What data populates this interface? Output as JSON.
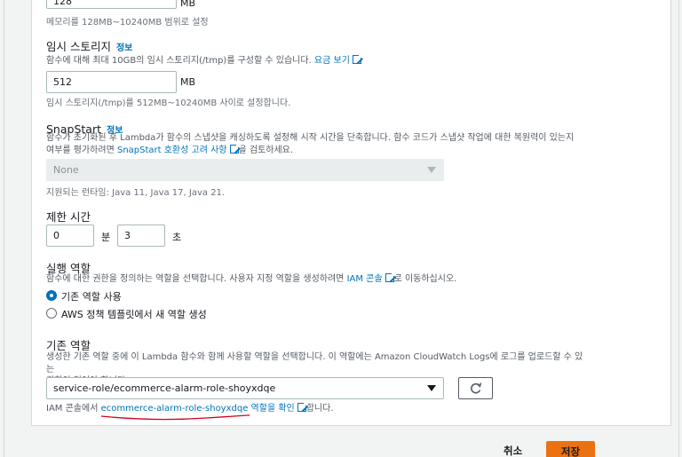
{
  "memory": {
    "value": "128",
    "unit": "MB",
    "hint": "메모리를 128MB~10240MB 범위로 설정"
  },
  "ephemeral": {
    "label": "임시 스토리지",
    "info": "정보",
    "desc_prefix": "함수에 대해 최대 10GB의 임시 스토리지(/tmp)를 구성할 수 있습니다.",
    "pricing_link": "요금 보기",
    "value": "512",
    "unit": "MB",
    "hint": "임시 스토리지(/tmp)를 512MB~10240MB 사이로 설정합니다."
  },
  "snapstart": {
    "label": "SnapStart",
    "info": "정보",
    "desc_line1": "함수가 초기화된 후 Lambda가 함수의 스냅샷을 캐싱하도록 설정해 시작 시간을 단축합니다. 함수 코드가 스냅샷 작업에 대한 복원력이 있는지",
    "desc_line2_prefix": "여부를 평가하려면",
    "compat_link": "SnapStart 호환성 고려 사항",
    "desc_line2_suffix": "을 검토하세요.",
    "selected": "None",
    "hint": "지원되는 런타임: Java 11, Java 17, Java 21."
  },
  "timeout": {
    "label": "제한 시간",
    "minutes_value": "0",
    "minutes_unit": "분",
    "seconds_value": "3",
    "seconds_unit": "초"
  },
  "exec_role": {
    "label": "실행 역할",
    "desc_prefix": "함수에 대한 권한을 정의하는 역할을 선택합니다. 사용자 지정 역할을 생성하려면",
    "console_link": "IAM 콘솔",
    "desc_suffix": "로 이동하십시오.",
    "option_existing": "기존 역할 사용",
    "option_template": "AWS 정책 템플릿에서 새 역할 생성"
  },
  "existing_role": {
    "label": "기존 역할",
    "desc_line1": "생성한 기존 역할 중에 이 Lambda 함수와 함께 사용할 역할을 선택합니다. 이 역할에는 Amazon CloudWatch Logs에 로그를 업로드할 수 있는",
    "desc_line2": "권한이 있어야 합니다.",
    "selected": "service-role/ecommerce-alarm-role-shoyxdqe",
    "footer_prefix": "IAM 콘솔에서",
    "footer_link": "ecommerce-alarm-role-shoyxdqe 역할을 확인",
    "footer_suffix": "합니다."
  },
  "actions": {
    "cancel": "취소",
    "save": "저장"
  },
  "colors": {
    "link": "#0073bb",
    "primary": "#ec7211",
    "annotation": "#d0021b"
  }
}
